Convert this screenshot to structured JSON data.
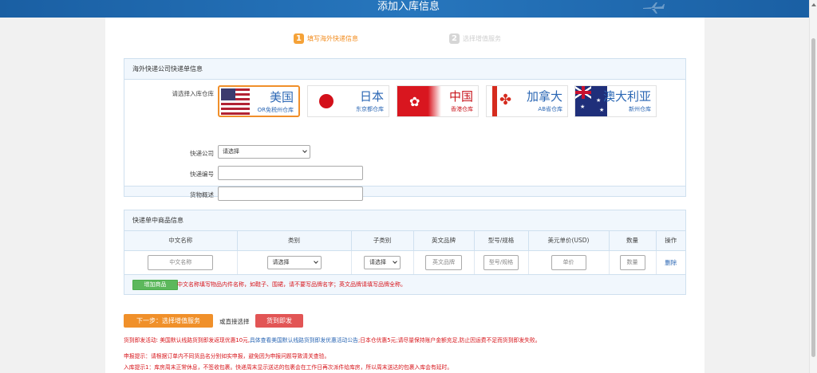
{
  "header": {
    "title": "添加入库信息"
  },
  "steps": [
    {
      "num": "1",
      "label": "填写海外快递信息",
      "active": true
    },
    {
      "num": "2",
      "label": "选择增值服务",
      "active": false
    }
  ],
  "section1": {
    "title": "海外快递公司快递单信息",
    "warehouse_label": "请选择入库仓库",
    "warehouses": [
      {
        "name": "美国",
        "sub": "OR免税州仓库",
        "flag": "us-flag-icon",
        "selected": true
      },
      {
        "name": "日本",
        "sub": "东京都仓库",
        "flag": "jp-flag-icon",
        "selected": false
      },
      {
        "name": "中国",
        "sub": "香港仓库",
        "flag": "hk-flag-icon",
        "selected": false
      },
      {
        "name": "加拿大",
        "sub": "AB省仓库",
        "flag": "ca-flag-icon",
        "selected": false
      },
      {
        "name": "澳大利亚",
        "sub": "新州仓库",
        "flag": "au-flag-icon",
        "selected": false
      }
    ],
    "courier_label": "快递公司",
    "courier_value": "请选择",
    "tracking_label": "快递编号",
    "goods_desc_label": "货物概述"
  },
  "section2": {
    "title": "快递单中商品信息",
    "columns": [
      "中文名称",
      "类别",
      "子类别",
      "英文品牌",
      "型号/规格",
      "美元单价(USD)",
      "数量",
      "操作"
    ],
    "row": {
      "cn_name_placeholder": "中文名称",
      "category_value": "请选择",
      "subcategory_value": "请选择",
      "brand_placeholder": "英文品牌",
      "model_placeholder": "型号/规格",
      "price_placeholder": "单价",
      "qty_placeholder": "数量",
      "delete_label": "删除"
    },
    "add_button": "增加商品",
    "add_tip": "中文名称填写物品内件名称，如鞋子、围裙，请不要写品牌名字；英文品牌请填写品牌全称。"
  },
  "actions": {
    "next_button": "下一步：选择增值服务",
    "or_text": "或直接选择",
    "send_button": "货到即发"
  },
  "notes": {
    "promo_prefix": "货到即发活动: 美国默认线路货到即发返现优惠10元,",
    "promo_link": "具体查看美国默认线路货到即发优惠活动公告",
    "promo_suffix": ";日本仓优惠5元;请尽量保持账户金额充足,防止因运费不足而货到即发失败。",
    "declare_tip": "申报提示：请根据订单内不同货品名分别如实申报，避免因为申报问题导致清关查验。",
    "storage_tip": "入库提示1：库房周末正常休息，不签收包裹。快递周末显示送达的包裹会在工作日再次派件给库房，所以周末送达的包裹入库会有延时。"
  }
}
